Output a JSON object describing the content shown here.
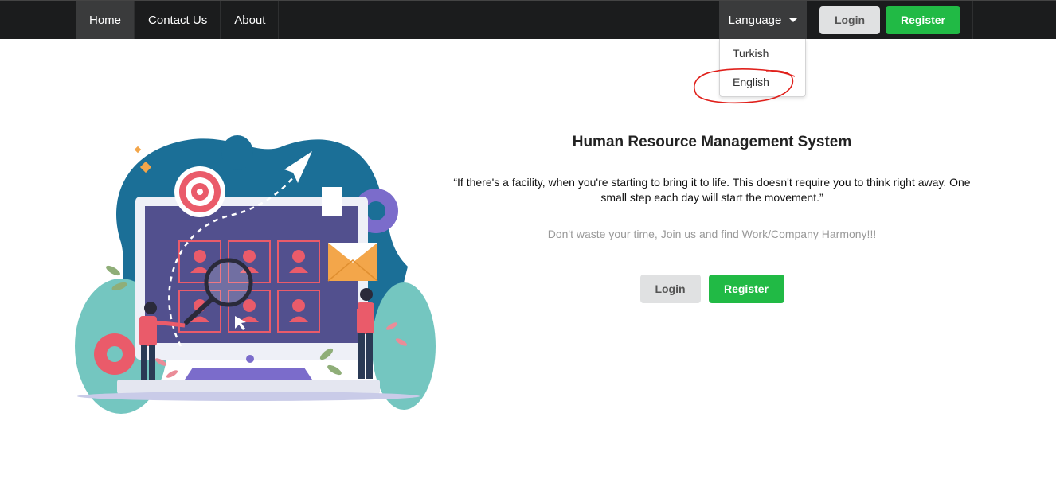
{
  "nav": {
    "links": [
      {
        "label": "Home",
        "active": true
      },
      {
        "label": "Contact Us",
        "active": false
      },
      {
        "label": "About",
        "active": false
      }
    ],
    "language_label": "Language",
    "login_label": "Login",
    "register_label": "Register"
  },
  "language_menu": {
    "options": [
      "Turkish",
      "English"
    ],
    "annotation_color": "#e0201b"
  },
  "hero": {
    "title": "Human Resource Management System",
    "quote": "“If there's a facility, when you're starting to bring it to life. This doesn't require you to think right away. One small step each day will start the movement.”",
    "subtitle": "Don't waste your time, Join us and find Work/Company Harmony!!!",
    "login_label": "Login",
    "register_label": "Register"
  },
  "colors": {
    "navbar": "#1b1c1d",
    "register_green": "#21ba45",
    "login_grey": "#e0e1e2"
  }
}
